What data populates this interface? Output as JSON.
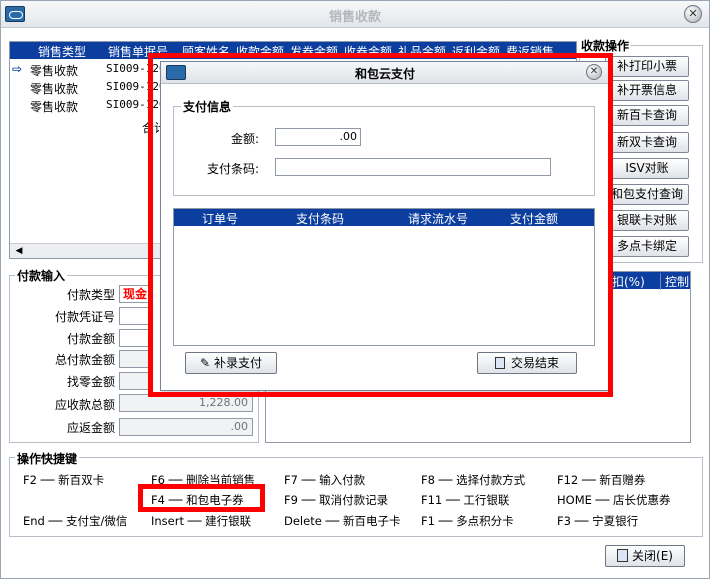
{
  "window": {
    "title": "销售收款"
  },
  "sales_table": {
    "headers": [
      "销售类型",
      "销售单据号",
      "顾客姓名",
      "收款金额",
      "发券金额",
      "收券金额",
      "礼品金额",
      "返利金额",
      "费返销售"
    ],
    "rows": [
      {
        "type": "零售收款",
        "doc": "SI009-1203"
      },
      {
        "type": "零售收款",
        "doc": "SI009-1203"
      },
      {
        "type": "零售收款",
        "doc": "SI009-1203"
      }
    ],
    "total_label": "合计"
  },
  "ops": {
    "title": "收款操作",
    "buttons": [
      "补打印小票",
      "补开票信息",
      "新百卡查询",
      "新双卡查询",
      "ISV对账",
      "和包支付查询",
      "银联卡对账",
      "多点卡绑定"
    ]
  },
  "payment_input": {
    "title": "付款输入",
    "labels": [
      "付款类型",
      "付款凭证号",
      "付款金额",
      "总付款金额",
      "找零金额",
      "应收款总额",
      "应返金额"
    ],
    "pay_type_value": "现金",
    "receivable_total": "1,228.00",
    "refund_amount": ".00"
  },
  "right_grid": {
    "headers": [
      "扣(%)",
      "控制"
    ]
  },
  "shortcuts": {
    "title": "操作快捷键",
    "items": [
      [
        "F2 ── 新百双卡",
        "F6 ── 删除当前销售",
        "F7 ── 输入付款",
        "F8 ── 选择付款方式",
        "F12 ── 新百赠券"
      ],
      [
        "",
        "F4 ── 和包电子券",
        "F9 ── 取消付款记录",
        "F11 ── 工行银联",
        "HOME ── 店长优惠券"
      ],
      [
        "End ── 支付宝/微信",
        "Insert ── 建行银联",
        "Delete ── 新百电子卡",
        "F1 ── 多点积分卡",
        "F3 ── 宁夏银行"
      ]
    ]
  },
  "close_button": "关闭(E)",
  "dialog": {
    "title": "和包云支付",
    "section_title": "支付信息",
    "amount_label": "金额:",
    "amount_value": ".00",
    "barcode_label": "支付条码:",
    "barcode_value": "",
    "grid_headers": [
      "订单号",
      "支付条码",
      "请求流水号",
      "支付金额"
    ],
    "supplement_button": "补录支付",
    "end_button": "交易结束"
  },
  "colors": {
    "header_blue": "#0b3e9e",
    "highlight_red": "#ff0000"
  }
}
